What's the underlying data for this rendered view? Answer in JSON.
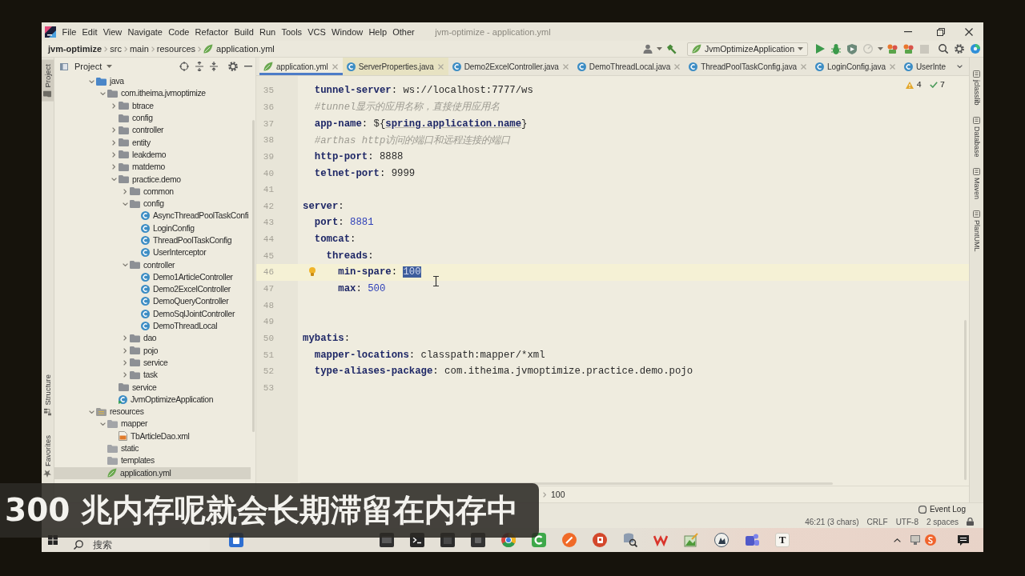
{
  "window": {
    "title": "jvm-optimize - application.yml"
  },
  "menu": [
    "File",
    "Edit",
    "View",
    "Navigate",
    "Code",
    "Refactor",
    "Build",
    "Run",
    "Tools",
    "VCS",
    "Window",
    "Help",
    "Other"
  ],
  "breadcrumb": [
    {
      "label": "jvm-optimize",
      "kind": "project"
    },
    {
      "label": "src",
      "kind": "folder"
    },
    {
      "label": "main",
      "kind": "folder"
    },
    {
      "label": "resources",
      "kind": "folder"
    },
    {
      "label": "application.yml",
      "kind": "yaml"
    }
  ],
  "run_config": {
    "label": "JvmOptimizeApplication"
  },
  "run_toolbar": [
    {
      "kind": "run",
      "disabled": false
    },
    {
      "kind": "debug",
      "disabled": false
    },
    {
      "kind": "coverage",
      "disabled": false
    },
    {
      "kind": "profile",
      "disabled": true
    },
    {
      "kind": "cluster",
      "disabled": false
    },
    {
      "kind": "cluster",
      "disabled": false
    },
    {
      "kind": "stop",
      "disabled": true
    }
  ],
  "left_tool_tabs": [
    {
      "label": "Project",
      "kind": "project",
      "selected": true
    },
    {
      "label": "Structure",
      "kind": "structure",
      "selected": false
    },
    {
      "label": "Favorites",
      "kind": "favorites",
      "selected": false
    }
  ],
  "right_tool_tabs": [
    "jclasslib",
    "Database",
    "Maven",
    "PlantUML"
  ],
  "project_panel": {
    "title": "Project"
  },
  "tree": [
    {
      "label": "java",
      "kind": "source",
      "expanded": true,
      "selected": false,
      "children": [
        {
          "label": "com.itheima.jvmoptimize",
          "kind": "package",
          "expanded": true,
          "selected": false,
          "children": [
            {
              "label": "btrace",
              "kind": "package",
              "expanded": false,
              "selected": false
            },
            {
              "label": "config",
              "kind": "package",
              "selected": false
            },
            {
              "label": "controller",
              "kind": "package",
              "expanded": false,
              "selected": false
            },
            {
              "label": "entity",
              "kind": "package",
              "expanded": false,
              "selected": false
            },
            {
              "label": "leakdemo",
              "kind": "package",
              "expanded": false,
              "selected": false
            },
            {
              "label": "matdemo",
              "kind": "package",
              "expanded": false,
              "selected": false
            },
            {
              "label": "practice.demo",
              "kind": "package",
              "expanded": true,
              "selected": false,
              "children": [
                {
                  "label": "common",
                  "kind": "package",
                  "expanded": false,
                  "selected": false
                },
                {
                  "label": "config",
                  "kind": "package",
                  "expanded": true,
                  "selected": false,
                  "children": [
                    {
                      "label": "AsyncThreadPoolTaskConfi",
                      "kind": "class",
                      "selected": false
                    },
                    {
                      "label": "LoginConfig",
                      "kind": "class",
                      "selected": false
                    },
                    {
                      "label": "ThreadPoolTaskConfig",
                      "kind": "class",
                      "selected": false
                    },
                    {
                      "label": "UserInterceptor",
                      "kind": "class",
                      "selected": false
                    }
                  ]
                },
                {
                  "label": "controller",
                  "kind": "package",
                  "expanded": true,
                  "selected": false,
                  "children": [
                    {
                      "label": "Demo1ArticleController",
                      "kind": "class",
                      "selected": false
                    },
                    {
                      "label": "Demo2ExcelController",
                      "kind": "class",
                      "selected": false
                    },
                    {
                      "label": "DemoQueryController",
                      "kind": "class",
                      "selected": false
                    },
                    {
                      "label": "DemoSqlJointController",
                      "kind": "class",
                      "selected": false
                    },
                    {
                      "label": "DemoThreadLocal",
                      "kind": "class",
                      "selected": false
                    }
                  ]
                },
                {
                  "label": "dao",
                  "kind": "package",
                  "expanded": false,
                  "selected": false
                },
                {
                  "label": "pojo",
                  "kind": "package",
                  "expanded": false,
                  "selected": false
                },
                {
                  "label": "service",
                  "kind": "package",
                  "expanded": false,
                  "selected": false
                },
                {
                  "label": "task",
                  "kind": "package",
                  "expanded": false,
                  "selected": false
                }
              ]
            },
            {
              "label": "service",
              "kind": "package",
              "selected": false
            },
            {
              "label": "JvmOptimizeApplication",
              "kind": "main",
              "selected": false
            }
          ]
        }
      ]
    },
    {
      "label": "resources",
      "kind": "resources",
      "expanded": true,
      "selected": false,
      "children": [
        {
          "label": "mapper",
          "kind": "folder",
          "expanded": true,
          "selected": false,
          "children": [
            {
              "label": "TbArticleDao.xml",
              "kind": "xml",
              "selected": false
            }
          ]
        },
        {
          "label": "static",
          "kind": "folder",
          "selected": false
        },
        {
          "label": "templates",
          "kind": "folder",
          "selected": false
        },
        {
          "label": "application.yml",
          "kind": "yaml",
          "selected": true
        }
      ]
    }
  ],
  "editor_tabs": [
    {
      "label": "application.yml",
      "kind": "yaml",
      "selected": true,
      "close": true
    },
    {
      "label": "ServerProperties.java",
      "kind": "library",
      "selected": false,
      "close": true
    },
    {
      "label": "Demo2ExcelController.java",
      "kind": "class",
      "selected": false,
      "close": true
    },
    {
      "label": "DemoThreadLocal.java",
      "kind": "class",
      "selected": false,
      "close": true
    },
    {
      "label": "ThreadPoolTaskConfig.java",
      "kind": "class",
      "selected": false,
      "close": true
    },
    {
      "label": "LoginConfig.java",
      "kind": "class",
      "selected": false,
      "close": true
    },
    {
      "label": "UserInte",
      "kind": "class",
      "selected": false,
      "close": false
    }
  ],
  "inspections": [
    {
      "kind": "warning",
      "count": "4"
    },
    {
      "kind": "check",
      "count": "7"
    }
  ],
  "lines": [
    {
      "number": "35",
      "current": false,
      "tokens": [
        {
          "kind": "key",
          "text": "  tunnel-server"
        },
        {
          "kind": "plain",
          "text": ": ws://localhost:7777/ws"
        }
      ]
    },
    {
      "number": "36",
      "current": false,
      "tokens": [
        {
          "kind": "comment",
          "text": "  #tunnel显示的应用名称，直接使用应用名"
        }
      ]
    },
    {
      "number": "37",
      "current": false,
      "tokens": [
        {
          "kind": "key",
          "text": "  app-name"
        },
        {
          "kind": "plain",
          "text": ": ${"
        },
        {
          "kind": "ref",
          "text": "spring.application.name"
        },
        {
          "kind": "plain",
          "text": "}"
        }
      ]
    },
    {
      "number": "38",
      "current": false,
      "tokens": [
        {
          "kind": "comment",
          "text": "  #arthas http访问的端口和远程连接的端口"
        }
      ]
    },
    {
      "number": "39",
      "current": false,
      "tokens": [
        {
          "kind": "key",
          "text": "  http-port"
        },
        {
          "kind": "plain",
          "text": ": 8888"
        }
      ]
    },
    {
      "number": "40",
      "current": false,
      "tokens": [
        {
          "kind": "key",
          "text": "  telnet-port"
        },
        {
          "kind": "plain",
          "text": ": 9999"
        }
      ]
    },
    {
      "number": "41",
      "current": false
    },
    {
      "number": "42",
      "current": false,
      "tokens": [
        {
          "kind": "key",
          "text": "server"
        },
        {
          "kind": "plain",
          "text": ":"
        }
      ]
    },
    {
      "number": "43",
      "current": false,
      "tokens": [
        {
          "kind": "key",
          "text": "  port"
        },
        {
          "kind": "plain",
          "text": ": "
        },
        {
          "kind": "number",
          "text": "8881"
        }
      ]
    },
    {
      "number": "44",
      "current": false,
      "tokens": [
        {
          "kind": "key",
          "text": "  tomcat"
        },
        {
          "kind": "plain",
          "text": ":"
        }
      ]
    },
    {
      "number": "45",
      "current": false,
      "tokens": [
        {
          "kind": "key",
          "text": "    threads"
        },
        {
          "kind": "plain",
          "text": ":"
        }
      ]
    },
    {
      "number": "46",
      "current": true,
      "bulb": true,
      "tokens": [
        {
          "kind": "key",
          "text": "      min-spare"
        },
        {
          "kind": "plain",
          "text": ": "
        },
        {
          "kind": "selection",
          "text": "100"
        }
      ]
    },
    {
      "number": "47",
      "current": false,
      "tokens": [
        {
          "kind": "key",
          "text": "      max"
        },
        {
          "kind": "plain",
          "text": ": "
        },
        {
          "kind": "number",
          "text": "500"
        }
      ]
    },
    {
      "number": "48",
      "current": false
    },
    {
      "number": "49",
      "current": false
    },
    {
      "number": "50",
      "current": false,
      "tokens": [
        {
          "kind": "key",
          "text": "mybatis"
        },
        {
          "kind": "plain",
          "text": ":"
        }
      ]
    },
    {
      "number": "51",
      "current": false,
      "tokens": [
        {
          "kind": "key",
          "text": "  mapper-locations"
        },
        {
          "kind": "plain",
          "text": ": classpath:mapper/*xml"
        }
      ]
    },
    {
      "number": "52",
      "current": false,
      "tokens": [
        {
          "kind": "key",
          "text": "  type-aliases-package"
        },
        {
          "kind": "plain",
          "text": ": com.itheima.jvmoptimize.practice.demo.pojo"
        }
      ]
    },
    {
      "number": "53",
      "current": false
    }
  ],
  "editor_breadcrumb": [
    "100"
  ],
  "tool_window_bar": {
    "event_log": "Event Log"
  },
  "status_bar": {
    "position": "46:21 (3 chars)",
    "line_separator": "CRLF",
    "encoding": "UTF-8",
    "indent": "2 spaces"
  },
  "taskbar": {
    "search": {
      "placeholder": "搜索"
    },
    "letter_tile": "T"
  },
  "subtitle": "300 兆内存呢就会长期滞留在内存中"
}
